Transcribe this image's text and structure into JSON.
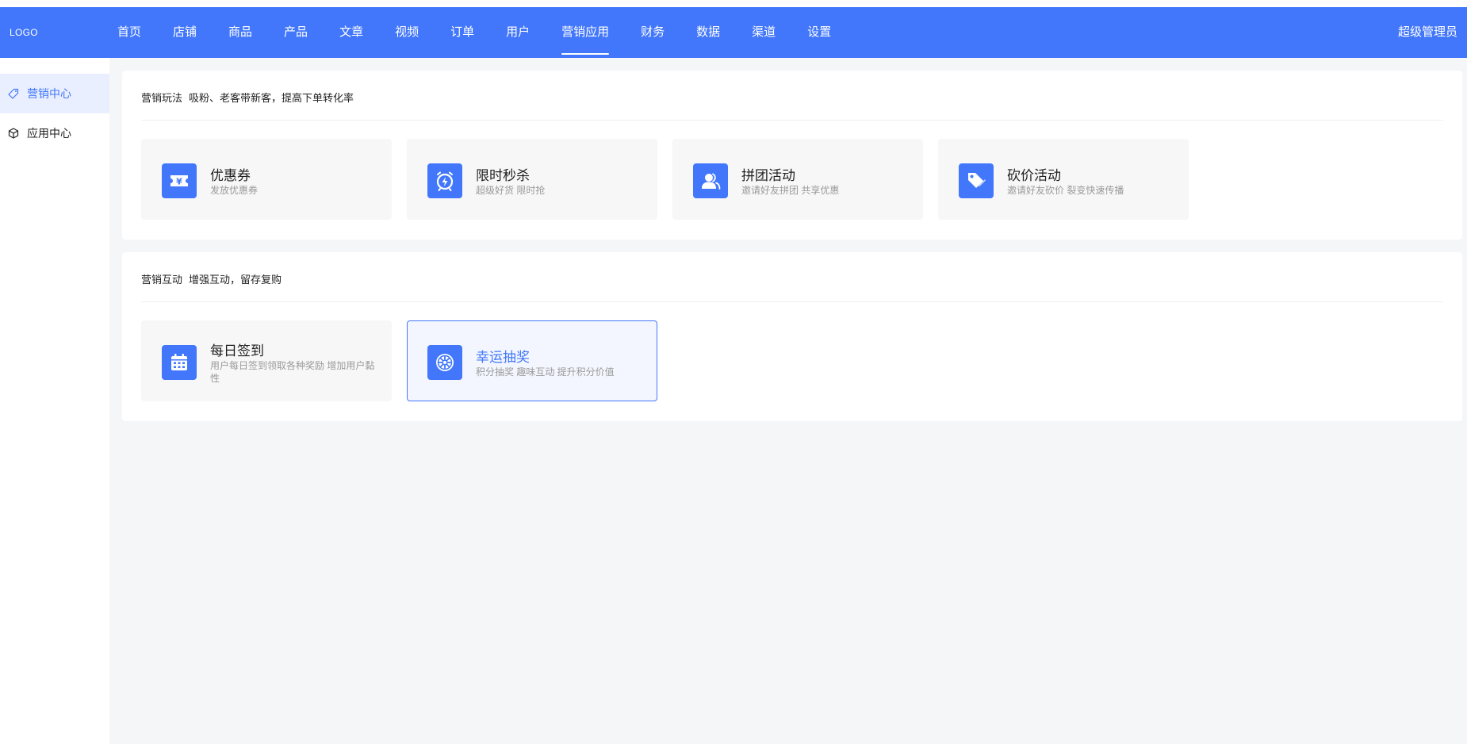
{
  "header": {
    "logo": "LOGO",
    "nav": [
      {
        "label": "首页"
      },
      {
        "label": "店铺"
      },
      {
        "label": "商品"
      },
      {
        "label": "产品"
      },
      {
        "label": "文章"
      },
      {
        "label": "视频"
      },
      {
        "label": "订单"
      },
      {
        "label": "用户"
      },
      {
        "label": "营销应用",
        "active": true
      },
      {
        "label": "财务"
      },
      {
        "label": "数据"
      },
      {
        "label": "渠道"
      },
      {
        "label": "设置"
      }
    ],
    "user": "超级管理员"
  },
  "sidebar": {
    "items": [
      {
        "label": "营销中心",
        "icon": "tag-icon",
        "active": true
      },
      {
        "label": "应用中心",
        "icon": "cube-icon"
      }
    ]
  },
  "sections": [
    {
      "title": "营销玩法",
      "subtitle": "吸粉、老客带新客，提高下单转化率",
      "cards": [
        {
          "title": "优惠券",
          "desc": "发放优惠券",
          "icon": "coupon-icon"
        },
        {
          "title": "限时秒杀",
          "desc": "超级好货 限时抢",
          "icon": "alarm-clock-icon"
        },
        {
          "title": "拼团活动",
          "desc": "邀请好友拼团 共享优惠",
          "icon": "group-users-icon"
        },
        {
          "title": "砍价活动",
          "desc": "邀请好友砍价 裂变快速传播",
          "icon": "price-tag-icon"
        }
      ]
    },
    {
      "title": "营销互动",
      "subtitle": "增强互动，留存复购",
      "cards": [
        {
          "title": "每日签到",
          "desc": "用户每日签到领取各种奖励 增加用户黏性",
          "icon": "calendar-icon"
        },
        {
          "title": "幸运抽奖",
          "desc": "积分抽奖 趣味互动 提升积分价值",
          "icon": "lottery-wheel-icon",
          "selected": true
        }
      ]
    }
  ],
  "colors": {
    "primary": "#4277fb",
    "background": "#f5f6f8",
    "card": "#f7f7f8",
    "sidebar_active": "#e9effe"
  }
}
